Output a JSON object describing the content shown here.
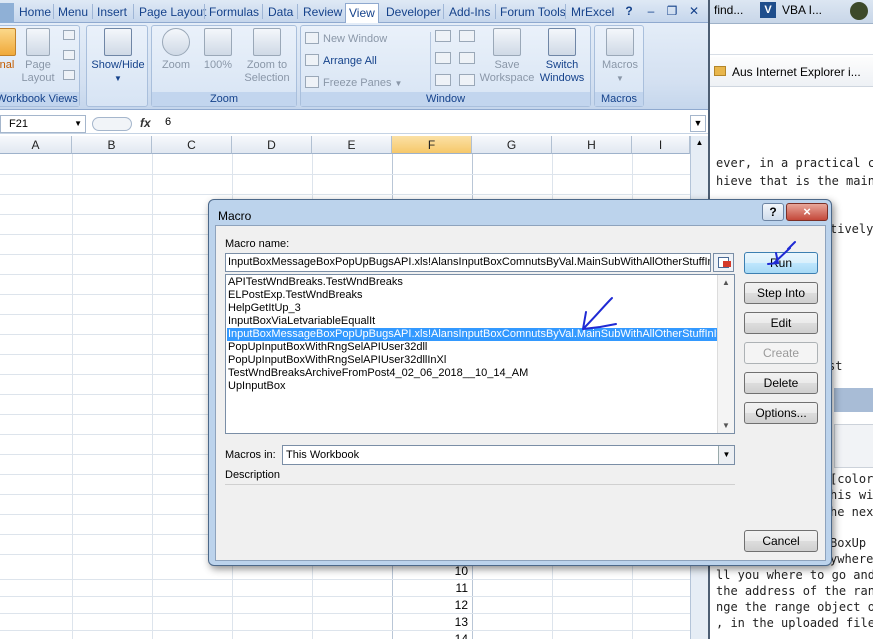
{
  "excel": {
    "tabs": [
      "Home",
      "Menu",
      "Insert",
      "Page Layout",
      "Formulas",
      "Data",
      "Review",
      "View",
      "Developer",
      "Add-Ins",
      "Forum Tools",
      "MrExcel"
    ],
    "active_tab": "View",
    "ribbon": {
      "workbook_views": {
        "label": "Workbook Views",
        "left_btn": "nal",
        "page_layout": "Page\nLayout"
      },
      "show_hide": {
        "label": "Show/Hide"
      },
      "zoom": {
        "label": "Zoom",
        "zoom": "Zoom",
        "pct100": "100%",
        "zoom_to_selection": "Zoom to\nSelection"
      },
      "window": {
        "label": "Window",
        "new_window": "New Window",
        "arrange_all": "Arrange All",
        "freeze_panes": "Freeze Panes",
        "save_workspace": "Save\nWorkspace",
        "switch_windows": "Switch\nWindows"
      },
      "macros": {
        "label": "Macros",
        "macros": "Macros"
      }
    },
    "name_box": "F21",
    "fx": "fx",
    "formula_value": "6",
    "columns": [
      "A",
      "B",
      "C",
      "D",
      "E",
      "F",
      "G",
      "H",
      "I"
    ],
    "selected_column": "F",
    "row_numbers": [
      "10",
      "11",
      "12",
      "13",
      "14"
    ]
  },
  "browser": {
    "tabs": [
      "find...",
      "VBA I..."
    ],
    "favorite": "Aus Internet Explorer i...",
    "lines": [
      "ever, in a practical codi",
      "hieve that is the main pu",
      "tively c",
      "st",
      "[color]",
      "his will",
      "he nex",
      "BoxUp",
      "ywhere",
      "ll you where to go and c",
      "the address of the rang",
      "nge the range object of",
      ", in the uploaded file, [F"
    ]
  },
  "dialog": {
    "title": "Macro",
    "help": "?",
    "close": "×",
    "macro_name_label": "Macro name:",
    "macro_name_value": "InputBoxMessageBoxPopUpBugsAPI.xls!AlansInputBoxComnutsByVal.MainSubWithAllOtherStuffInIt",
    "macros": [
      "APITestWndBreaks.TestWndBreaks",
      "ELPostExp.TestWndBreaks",
      "HelpGetItUp_3",
      "InputBoxViaLetvariableEqualIt",
      "InputBoxMessageBoxPopUpBugsAPI.xls!AlansInputBoxComnutsByVal.MainSubWithAllOtherStuffInIt",
      "PopUpInputBoxWithRngSelAPIUser32dll",
      "PopUpInputBoxWithRngSelAPIUser32dllInXl",
      "TestWndBreaksArchiveFromPost4_02_06_2018__10_14_AM",
      "UpInputBox"
    ],
    "selected_index": 4,
    "macros_in_label": "Macros in:",
    "macros_in_value": "This Workbook",
    "description_label": "Description",
    "buttons": {
      "run": "Run",
      "step_into": "Step Into",
      "edit": "Edit",
      "create": "Create",
      "delete": "Delete",
      "options": "Options...",
      "cancel": "Cancel"
    },
    "annotation_color": "#1f2ad4"
  }
}
